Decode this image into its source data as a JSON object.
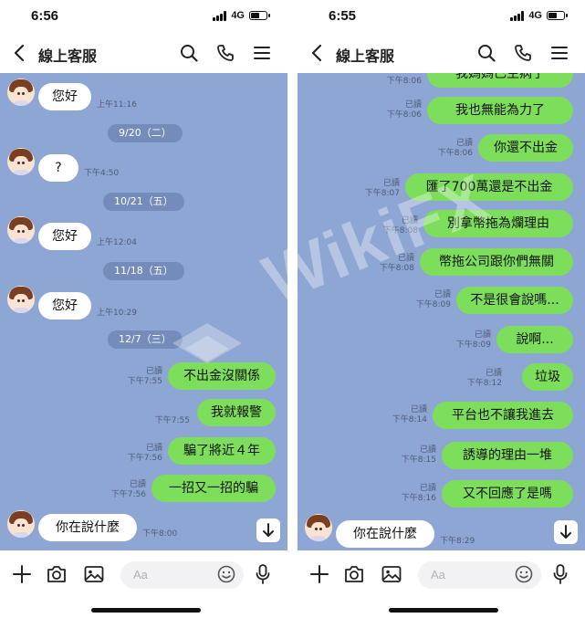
{
  "status_left": {
    "time": "6:56",
    "network": "4G"
  },
  "status_right": {
    "time": "6:55",
    "network": "4G"
  },
  "header": {
    "title": "線上客服"
  },
  "icons": {
    "back": "chevron-left-icon",
    "search": "search-icon",
    "call": "phone-icon",
    "menu": "menu-icon",
    "add": "plus-icon",
    "camera": "camera-icon",
    "image": "image-icon",
    "emoji": "emoji-icon",
    "mic": "microphone-icon",
    "scroll": "arrow-down-icon"
  },
  "input": {
    "placeholder": "Aa"
  },
  "read_label": "已讀",
  "watermark": {
    "text": "WikiFX"
  },
  "colors": {
    "chat_bg": "#8ea6d3",
    "outgoing_bubble": "#7dde5b",
    "incoming_bubble": "#ffffff",
    "date_chip": "#6c82b0"
  },
  "left_panel": {
    "dates": [
      "9/20（二）",
      "10/21（五）",
      "11/18（五）",
      "12/7（三）"
    ],
    "incoming": [
      {
        "text": "您好",
        "time": "上午11:16"
      },
      {
        "text": "?",
        "time": "下午4:50"
      },
      {
        "text": "您好",
        "time": "上午12:04"
      },
      {
        "text": "您好",
        "time": "上午10:29"
      },
      {
        "text": "你在說什麼",
        "time": "下午8:00"
      }
    ],
    "outgoing": [
      {
        "text": "不出金沒關係",
        "time": "下午7:55"
      },
      {
        "text": "我就報警",
        "time": "下午7:55"
      },
      {
        "text": "騙了將近４年",
        "time": "下午7:56"
      },
      {
        "text": "一招又一招的騙",
        "time": "下午7:56"
      }
    ]
  },
  "right_panel": {
    "outgoing": [
      {
        "text": "我媽媽已生病了",
        "time": "下午8:06"
      },
      {
        "text": "我也無能為力了",
        "time": "下午8:06"
      },
      {
        "text": "你還不出金",
        "time": "下午8:06"
      },
      {
        "text": "匯了700萬還是不出金",
        "time": "下午8:07"
      },
      {
        "text": "別拿幣拖為爛理由",
        "time": "下午8:08"
      },
      {
        "text": "幣拖公司跟你們無關",
        "time": "下午8:08"
      },
      {
        "text": "不是很會說嗎...",
        "time": "下午8:09"
      },
      {
        "text": "說啊...",
        "time": "下午8:09"
      },
      {
        "text": "垃圾",
        "time": "下午8:12"
      },
      {
        "text": "平台也不讓我進去",
        "time": "下午8:14"
      },
      {
        "text": "誘導的理由一堆",
        "time": "下午8:15"
      },
      {
        "text": "又不回應了是嗎",
        "time": "下午8:16"
      }
    ],
    "incoming": [
      {
        "text": "你在說什麼",
        "time": "下午8:29"
      }
    ]
  }
}
